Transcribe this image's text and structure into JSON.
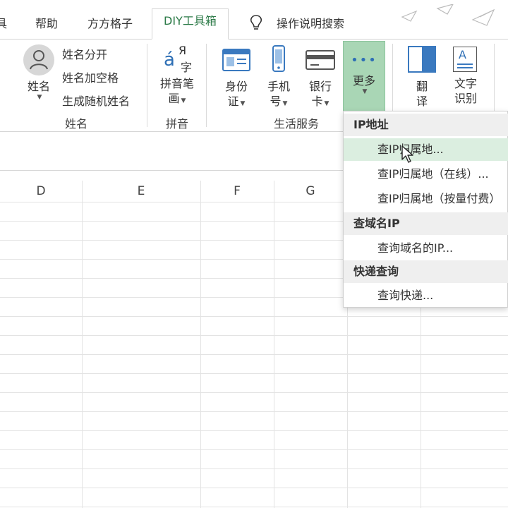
{
  "tabs": [
    {
      "label": "具",
      "active": false
    },
    {
      "label": "帮助",
      "active": false
    },
    {
      "label": "方方格子",
      "active": false
    },
    {
      "label": "DIY工具箱",
      "active": true
    },
    {
      "label": "操作说明搜索",
      "active": false
    }
  ],
  "colors": {
    "accent": "#2b7a47",
    "menu_hover": "#dbeee0",
    "more_button_bg": "#a9d6b5"
  },
  "ribbon": {
    "name_group": {
      "label": "姓名",
      "big_button": "姓名",
      "small_buttons": [
        "姓名分开",
        "姓名加空格",
        "生成随机姓名"
      ]
    },
    "pinyin_group": {
      "label": "拼音",
      "button_line1": "拼音笔",
      "button_line2": "画",
      "icon_text_a": "á",
      "icon_text_r": "Я",
      "icon_text_z": "字"
    },
    "life_group": {
      "label": "生活服务",
      "id_line1": "身份",
      "id_line2": "证",
      "phone_line1": "手机",
      "phone_line2": "号",
      "bank_line1": "银行",
      "bank_line2": "卡",
      "more_label": "更多",
      "more_dots": "•••"
    },
    "translate_line1": "翻",
    "translate_line2": "译",
    "ocr_line1": "文字",
    "ocr_line2": "识别",
    "ocr_icon_letter": "A"
  },
  "columns": [
    "D",
    "E",
    "F",
    "G"
  ],
  "menu": {
    "sections": [
      {
        "title": "IP地址",
        "items": [
          "查IP归属地...",
          "查IP归属地（在线）...",
          "查IP归属地（按量付费）"
        ]
      },
      {
        "title": "查域名IP",
        "items": [
          "查询域名的IP..."
        ]
      },
      {
        "title": "快递查询",
        "items": [
          "查询快递..."
        ]
      }
    ],
    "hovered_item": "查IP归属地..."
  }
}
